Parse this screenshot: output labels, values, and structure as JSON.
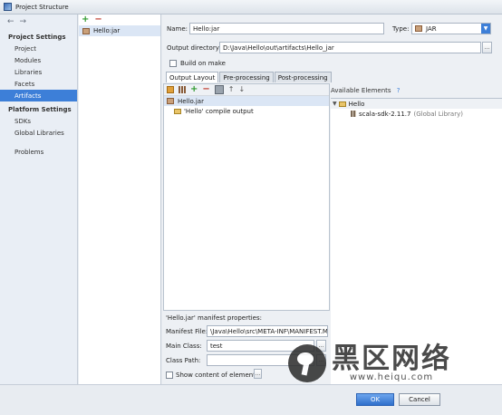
{
  "window": {
    "title": "Project Structure"
  },
  "sidebar": {
    "project_settings_header": "Project Settings",
    "project_items": [
      {
        "label": "Project"
      },
      {
        "label": "Modules"
      },
      {
        "label": "Libraries"
      },
      {
        "label": "Facets"
      },
      {
        "label": "Artifacts",
        "selected": true
      }
    ],
    "platform_settings_header": "Platform Settings",
    "platform_items": [
      {
        "label": "SDKs"
      },
      {
        "label": "Global Libraries"
      }
    ],
    "other_items": [
      {
        "label": "Problems"
      }
    ]
  },
  "artifacts": {
    "items": [
      {
        "label": "Hello:jar"
      }
    ]
  },
  "form": {
    "name_label": "Name:",
    "name_value": "Hello:jar",
    "type_label": "Type:",
    "type_value": "JAR",
    "output_dir_label": "Output directory:",
    "output_dir_value": "D:\\Java\\Hello\\out\\artifacts\\Hello_jar",
    "build_on_make_label": "Build on make",
    "build_on_make_checked": false
  },
  "tabs": [
    {
      "label": "Output Layout",
      "active": true
    },
    {
      "label": "Pre-processing"
    },
    {
      "label": "Post-processing"
    }
  ],
  "output_layout": {
    "tree": [
      {
        "label": "Hello.jar"
      },
      {
        "label": "'Hello' compile output"
      }
    ]
  },
  "available_elements": {
    "header": "Available Elements",
    "help": "?",
    "tree": [
      {
        "label": "Hello"
      },
      {
        "label": "scala-sdk-2.11.7",
        "suffix": "(Global Library)"
      }
    ]
  },
  "manifest": {
    "header": "'Hello.jar' manifest properties:",
    "manifest_file_label": "Manifest File:",
    "manifest_file_value": "\\Java\\Hello\\src\\META-INF\\MANIFEST.MF",
    "main_class_label": "Main Class:",
    "main_class_value": "test",
    "class_path_label": "Class Path:",
    "class_path_value": "",
    "show_content_label": "Show content of elements",
    "ellipsis": "..."
  },
  "footer": {
    "ok_label": "OK",
    "cancel_label": "Cancel"
  },
  "watermark": {
    "big_text": "黑区网络",
    "url": "www.heiqu.com"
  }
}
